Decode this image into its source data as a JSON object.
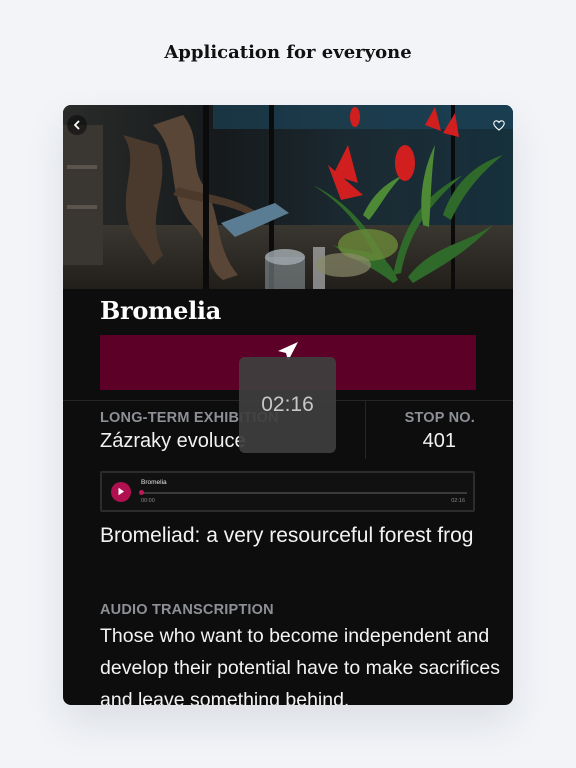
{
  "marketing": {
    "headline": "Application for everyone"
  },
  "stop": {
    "title": "Bromelia",
    "exhibition_label": "LONG-TERM EXHIBITION",
    "exhibition_value": "Zázraky evoluce",
    "stop_label": "STOP NO.",
    "stop_value": "401"
  },
  "overlay": {
    "timer": "02:16"
  },
  "player": {
    "track_title": "Bromelia",
    "time_current": "00:00",
    "time_total": "02:16",
    "progress": 0,
    "accent_color": "#b01050"
  },
  "content": {
    "headline": "Bromeliad: a very resourceful forest frog",
    "transcription_label": "AUDIO TRANSCRIPTION",
    "transcription": "Those who want to become independent and develop their potential have to make sacrifices and leave something behind."
  },
  "icons": {
    "back": "chevron-left-icon",
    "favorite": "heart-icon",
    "navigate": "navigation-arrow-icon",
    "play": "play-icon"
  },
  "colors": {
    "nav_bar": "#5c0028",
    "background": "#0d0d0d",
    "page": "#f2f4f8"
  }
}
